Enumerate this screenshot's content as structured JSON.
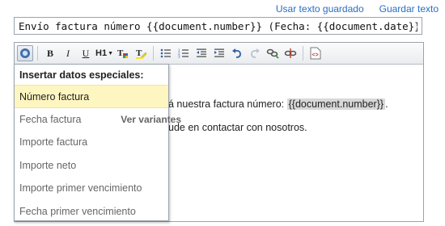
{
  "top_links": {
    "use_saved": "Usar texto guardado",
    "save": "Guardar texto"
  },
  "subject": {
    "value": "Envío factura número {{document.number}} (Fecha: {{document.date}})"
  },
  "editor": {
    "line1_prefix": "á nuestra factura número: ",
    "line1_var": "{{document.number}}",
    "line1_suffix": ".",
    "line2": "ude en contactar con nosotros."
  },
  "toolbar": {
    "heading_label": "H1"
  },
  "dropdown": {
    "title": "Insertar datos especiales:",
    "items": [
      {
        "label": "Número factura"
      },
      {
        "label": "Fecha factura",
        "extra": "Ver variantes"
      },
      {
        "label": "Importe factura"
      },
      {
        "label": "Importe neto"
      },
      {
        "label": "Importe primer vencimiento"
      },
      {
        "label": "Fecha primer vencimiento"
      }
    ]
  },
  "colors": {
    "link": "#2a6cc4",
    "selected_bg": "#fdf6c0",
    "var_highlight": "#d8d8d8"
  }
}
